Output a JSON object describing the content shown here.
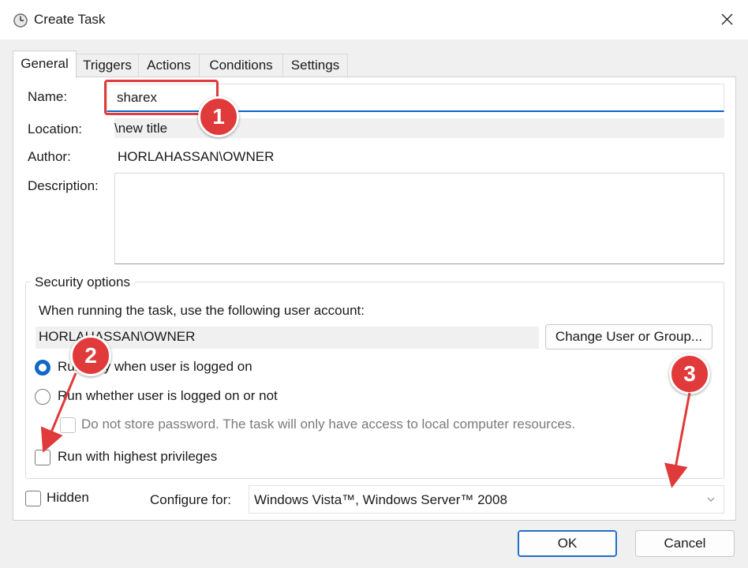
{
  "window": {
    "title": "Create Task",
    "icon": "clock-icon",
    "close_icon": "close-icon"
  },
  "tabs": [
    {
      "label": "General",
      "active": true
    },
    {
      "label": "Triggers",
      "active": false
    },
    {
      "label": "Actions",
      "active": false
    },
    {
      "label": "Conditions",
      "active": false
    },
    {
      "label": "Settings",
      "active": false
    }
  ],
  "general": {
    "name_label": "Name:",
    "name_value": "sharex",
    "location_label": "Location:",
    "location_value": "\\new title",
    "author_label": "Author:",
    "author_value": "HORLAHASSAN\\OWNER",
    "description_label": "Description:",
    "description_value": ""
  },
  "security": {
    "group_title": "Security options",
    "account_prompt": "When running the task, use the following user account:",
    "account_value": "HORLAHASSAN\\OWNER",
    "change_user_button": "Change User or Group...",
    "radio_logged_on": "Run only when user is logged on",
    "radio_logged_on_selected": true,
    "radio_whether": "Run whether user is logged on or not",
    "radio_whether_selected": false,
    "no_store_password": "Do not store password.  The task will only have access to local computer resources.",
    "highest_privileges": "Run with highest privileges",
    "highest_privileges_checked": false
  },
  "bottom": {
    "hidden_label": "Hidden",
    "hidden_checked": false,
    "configure_label": "Configure for:",
    "configure_value": "Windows Vista™, Windows Server™ 2008"
  },
  "buttons": {
    "ok": "OK",
    "cancel": "Cancel"
  },
  "annotations": {
    "badge_1": "1",
    "badge_2": "2",
    "badge_3": "3",
    "color": "#e03a3a"
  },
  "colors": {
    "accent": "#1168c8",
    "dialog_bg": "#f0f0f0"
  }
}
